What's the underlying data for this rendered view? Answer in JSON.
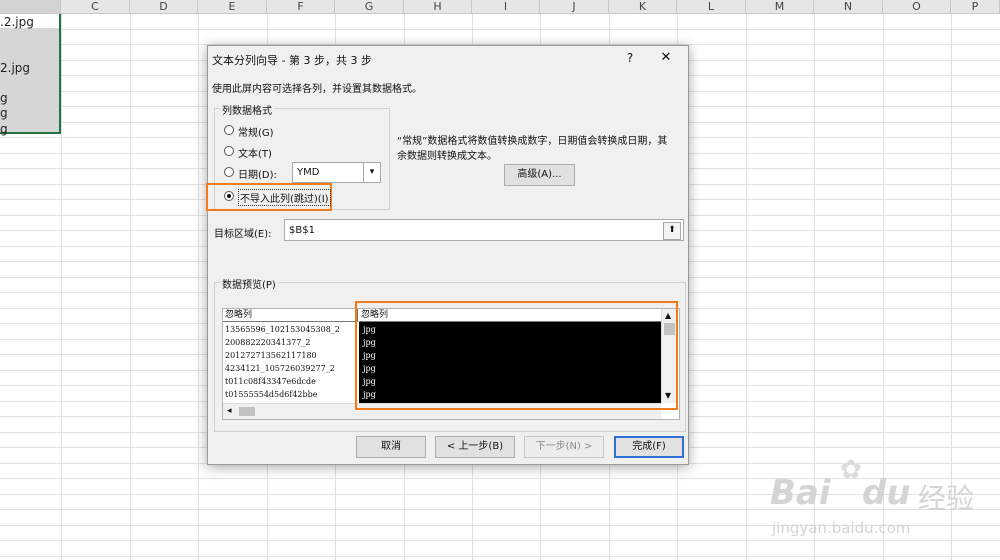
{
  "spreadsheet": {
    "columns": [
      "C",
      "D",
      "E",
      "F",
      "G",
      "H",
      "I",
      "J",
      "K",
      "L",
      "M",
      "N",
      "O",
      "P"
    ],
    "cells": [
      ".2.jpg",
      "",
      "",
      "2.jpg",
      "g",
      "g",
      "",
      "g"
    ]
  },
  "dialog": {
    "title": "文本分列向导 - 第 3 步，共 3 步",
    "help_label": "?",
    "close_label": "✕",
    "instruction": "使用此屏内容可选择各列，并设置其数据格式。",
    "column_format": {
      "legend": "列数据格式",
      "general_label": "常规(G)",
      "text_label": "文本(T)",
      "date_label": "日期(D):",
      "date_value": "YMD",
      "skip_label": "不导入此列(跳过)(I)"
    },
    "description": "“常规”数据格式将数值转换成数字，日期值会转换成日期，其余数据则转换成文本。",
    "advanced_label": "高级(A)...",
    "destination_label": "目标区域(E):",
    "destination_value": "$B$1",
    "preview": {
      "legend": "数据预览(P)",
      "col1_header": "忽略列",
      "col2_header": "忽略列",
      "col1_rows": [
        "13565596_102153045308_2",
        "200882220341377_2",
        "201272713562117180",
        "4234121_105726039277_2",
        "t011c08f43347e6dcde",
        "t01555554d5d6f42bbe"
      ],
      "col2_rows": [
        "jpg",
        "jpg",
        "jpg",
        "jpg",
        "jpg",
        "jpg"
      ]
    },
    "buttons": {
      "cancel": "取消",
      "back": "< 上一步(B)",
      "next": "下一步(N) >",
      "finish": "完成(F)"
    }
  },
  "watermark": {
    "brand": "Bai",
    "brand2": "du",
    "brand_cn": "经验",
    "url": "jingyan.baidu.com"
  }
}
